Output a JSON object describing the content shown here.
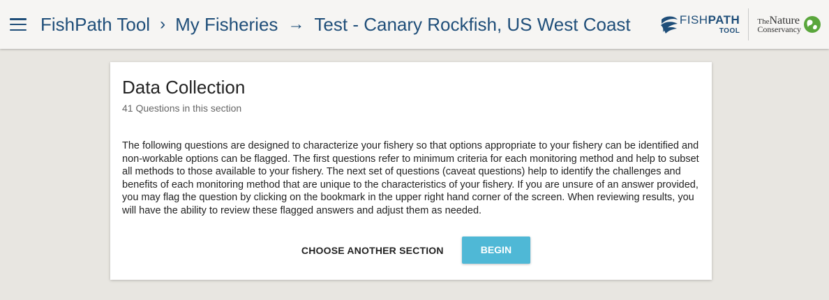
{
  "header": {
    "menu_icon": "hamburger-menu-icon",
    "breadcrumb": [
      {
        "label": "FishPath Tool"
      },
      {
        "label": "My Fisheries"
      },
      {
        "label": "Test - Canary Rockfish, US West Coast"
      }
    ],
    "separators": [
      "›",
      "→"
    ],
    "logos": {
      "fishpath": {
        "word_light": "FISH",
        "word_bold": "PATH",
        "sub": "TOOL"
      },
      "tnc": {
        "the": "The",
        "nature": "Nature",
        "conservancy": "Conservancy"
      }
    }
  },
  "section": {
    "title": "Data Collection",
    "subtitle": "41 Questions in this section",
    "description": "The following questions are designed to characterize your fishery so that options appropriate to your fishery can be identified and non-workable options can be flagged. The first questions refer to minimum criteria for each monitoring method and help to subset all methods to those available to your fishery. The next set of questions (caveat questions) help to identify the challenges and benefits of each monitoring method that are unique to the characteristics of your fishery. If you are unsure of an answer provided, you may flag the question by clicking on the bookmark in the upper right hand corner of the screen. When reviewing results, you will have the ability to review these flagged answers and adjust them as needed.",
    "actions": {
      "secondary_label": "CHOOSE ANOTHER SECTION",
      "primary_label": "BEGIN"
    }
  },
  "colors": {
    "brand_blue": "#1f4e79",
    "accent": "#4fb8d6",
    "background": "#e8e6e1",
    "topbar": "#f6f5f3"
  }
}
